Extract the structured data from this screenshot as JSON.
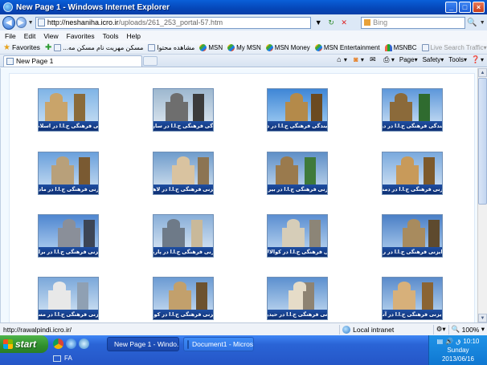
{
  "window": {
    "title": "New Page 1 - Windows Internet Explorer",
    "minimize": "_",
    "maximize": "□",
    "close": "×"
  },
  "address": {
    "url_host": "http://neshaniha.icro.ir",
    "url_path": "/uploads/261_253_portal-57.htm",
    "search_placeholder": "Bing"
  },
  "menu": [
    "File",
    "Edit",
    "View",
    "Favorites",
    "Tools",
    "Help"
  ],
  "favorites": {
    "label": "Favorites",
    "items": [
      {
        "label": "...مسکن مهریت نام مسکن مه",
        "icon": "page",
        "dim": false
      },
      {
        "label": "مشاهده محتوا",
        "icon": "page",
        "dim": false
      },
      {
        "label": "MSN",
        "icon": "msn",
        "dim": false
      },
      {
        "label": "My MSN",
        "icon": "msn",
        "dim": false
      },
      {
        "label": "MSN Money",
        "icon": "msn",
        "dim": false
      },
      {
        "label": "MSN Entertainment",
        "icon": "msn",
        "dim": false
      },
      {
        "label": "MSNBC",
        "icon": "msnbc",
        "dim": false
      },
      {
        "label": "Live Search Traffic",
        "icon": "page",
        "dim": true
      }
    ]
  },
  "tab": {
    "label": "New Page 1"
  },
  "commandbar": {
    "page": "Page",
    "safety": "Safety",
    "tools": "Tools"
  },
  "tiles": [
    {
      "caption": "رایزنی فرهنگی ج.ا.ا در اسلام آباد"
    },
    {
      "caption": "نمایندگی فرهنگی ج.ا.ا در ساراژیوو"
    },
    {
      "caption": "نمایندگی فرهنگی ج.ا.ا در داکا"
    },
    {
      "caption": "نمایندگی فرهنگی ج.ا.ا در دوحه"
    },
    {
      "caption": "رایزنی فرهنگی ج.ا.ا در مادرید"
    },
    {
      "caption": "رایزنی فرهنگی ج.ا.ا در لاهور"
    },
    {
      "caption": "رایزنی فرهنگی ج.ا.ا در بیروت"
    },
    {
      "caption": "رایزنی فرهنگی ج.ا.ا در دمشق"
    },
    {
      "caption": "رایزنی فرهنگی ج.ا.ا در برلین"
    },
    {
      "caption": "رایزنی فرهنگی ج.ا.ا در پاریس"
    },
    {
      "caption": "رایزنی فرهنگی ج.ا.ا در کوالالامپور"
    },
    {
      "caption": "رایزنی فرهنگی ج.ا.ا در رم"
    },
    {
      "caption": "رایزنی فرهنگی ج.ا.ا در مسکو"
    },
    {
      "caption": "رایزنی فرهنگی ج.ا.ا در کویت"
    },
    {
      "caption": "رایزنی فرهنگی ج.ا.ا در حیدرآباد"
    },
    {
      "caption": "رایزنی فرهنگی ج.ا.ا در آتن"
    }
  ],
  "status": {
    "url": "http://rawalpindi.icro.ir/",
    "zone": "Local intranet",
    "zoom": "100%"
  },
  "taskbar": {
    "start": "start",
    "tasks": [
      {
        "label": "New Page 1 - Windo..."
      },
      {
        "label": "Document1 - Microsof..."
      }
    ],
    "lang": "FA",
    "tray_lang": "ق",
    "time": "10:10",
    "day": "Sunday",
    "date": "2013/06/16"
  },
  "colors": {
    "titlebar": "#0a5fd8",
    "caption_band": "#1f4fa3",
    "start_green": "#2f8f2c"
  }
}
